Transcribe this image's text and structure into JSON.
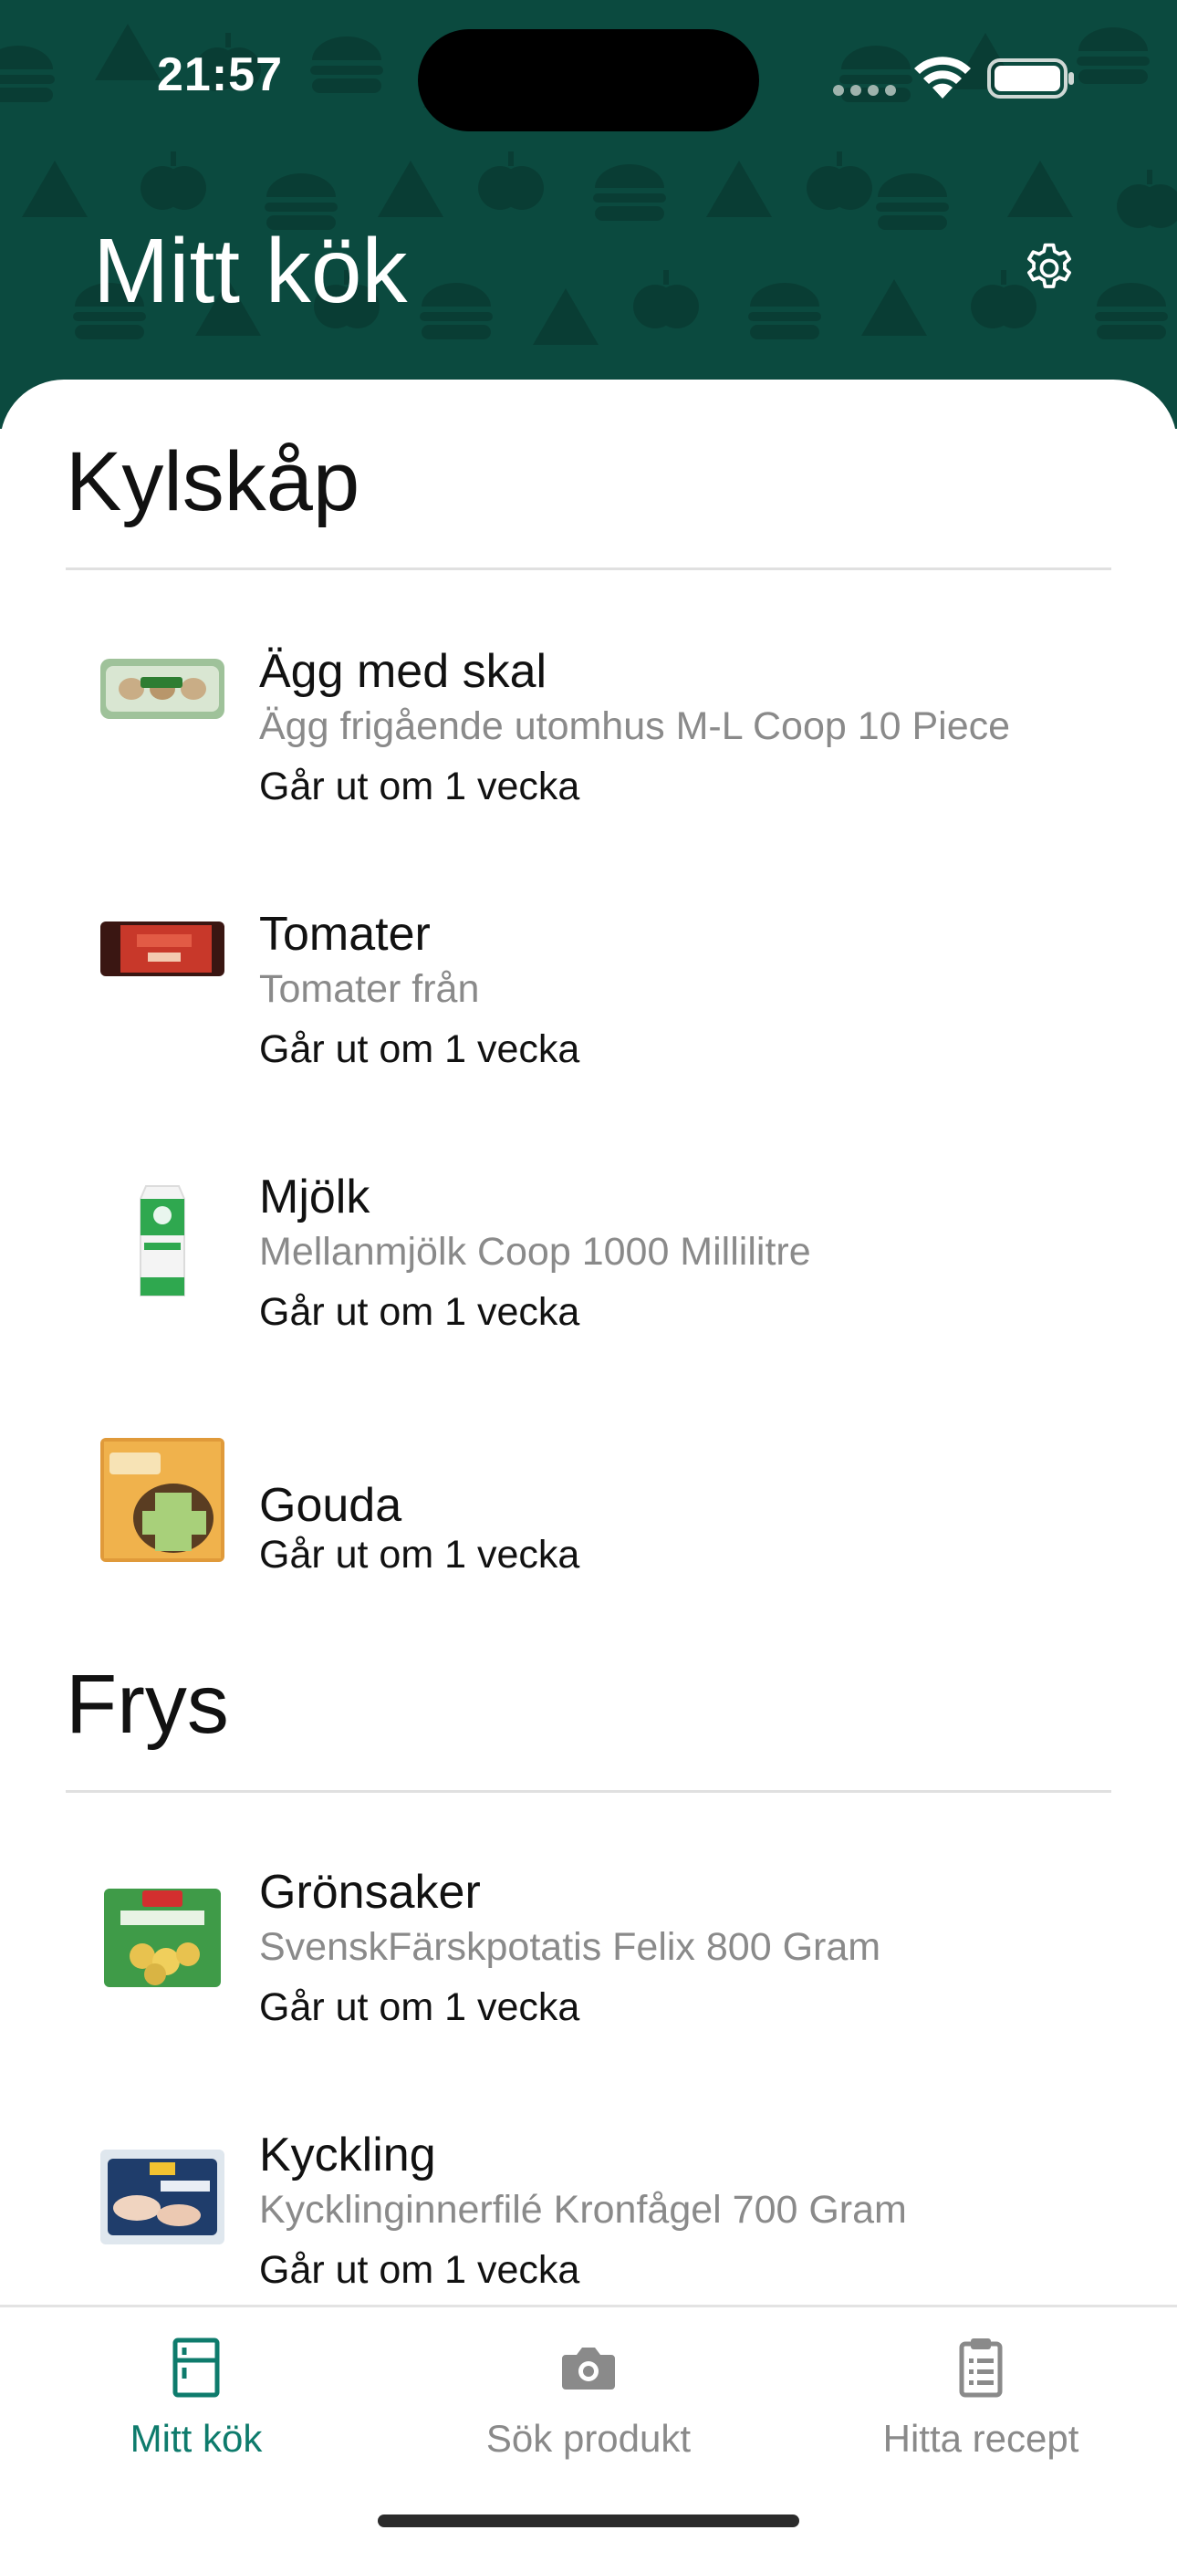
{
  "status_bar": {
    "time": "21:57"
  },
  "header": {
    "title": "Mitt kök",
    "settings_icon": "gear-icon",
    "background_color": "#0b4a3f"
  },
  "sections": [
    {
      "title": "Kylskåp",
      "items": [
        {
          "name": "Ägg med skal",
          "description": "Ägg frigående utomhus M-L Coop 10 Piece",
          "expiry": "Går ut om 1 vecka"
        },
        {
          "name": "Tomater",
          "description": "Tomater från",
          "expiry": "Går ut om 1 vecka"
        },
        {
          "name": "Mjölk",
          "description": "Mellanmjölk Coop 1000 Millilitre",
          "expiry": "Går ut om 1 vecka"
        },
        {
          "name": "Gouda",
          "description": "",
          "expiry": "Går ut om 1 vecka"
        }
      ]
    },
    {
      "title": "Frys",
      "items": [
        {
          "name": "Grönsaker",
          "description": "SvenskFärskpotatis Felix 800 Gram",
          "expiry": "Går ut om 1 vecka"
        },
        {
          "name": "Kyckling",
          "description": "Kycklinginnerfilé Kronfågel 700 Gram",
          "expiry": "Går ut om 1 vecka"
        }
      ]
    }
  ],
  "tabbar": {
    "tabs": [
      {
        "label": "Mitt kök",
        "icon": "fridge-icon",
        "active": true
      },
      {
        "label": "Sök produkt",
        "icon": "camera-icon",
        "active": false
      },
      {
        "label": "Hitta recept",
        "icon": "clipboard-icon",
        "active": false
      }
    ],
    "active_color": "#0e7b6c",
    "inactive_color": "#8a8a8a"
  }
}
